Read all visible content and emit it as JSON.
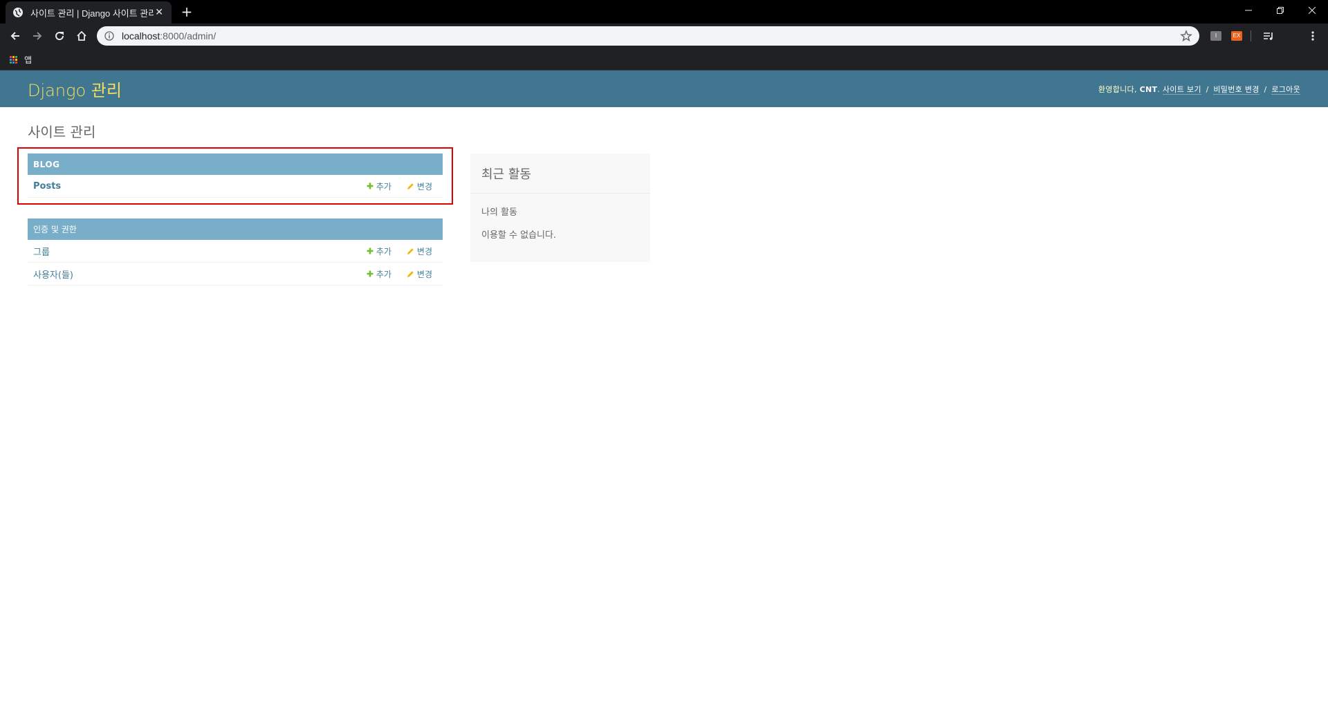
{
  "browser": {
    "tab_title": "사이트 관리 | Django 사이트 관리",
    "tab_close": "✕",
    "new_tab": "+",
    "url_host": "localhost",
    "url_rest": ":8000/admin/",
    "bookmarks": {
      "apps_label": "앱"
    },
    "extensions": {
      "ext1": "I",
      "ext2": "EX"
    }
  },
  "header": {
    "branding": "Django 관리",
    "welcome": "환영합니다,",
    "username": "CNT",
    "view_site": "사이트 보기",
    "change_password": "비밀번호 변경",
    "logout": "로그아웃",
    "separator": "/"
  },
  "content": {
    "title": "사이트 관리",
    "modules": [
      {
        "caption": "Blog",
        "rows": [
          {
            "name": "Posts",
            "add": "추가",
            "change": "변경"
          }
        ]
      },
      {
        "caption": "인증 및 권한",
        "rows": [
          {
            "name": "그룹",
            "add": "추가",
            "change": "변경"
          },
          {
            "name": "사용자(들)",
            "add": "추가",
            "change": "변경"
          }
        ]
      }
    ],
    "recent": {
      "title": "최근 활동",
      "subtitle": "나의 활동",
      "empty": "이용할 수 없습니다."
    }
  },
  "colors": {
    "header_bg": "#417690",
    "branding": "#f5dd5d",
    "module_caption_bg": "#79aec8",
    "link": "#447e9b",
    "add_icon": "#70bf2b",
    "change_icon": "#efb80b",
    "highlight_border": "#e00000"
  },
  "icons": [
    "globe-icon",
    "back-icon",
    "forward-icon",
    "reload-icon",
    "home-icon",
    "info-icon",
    "star-icon",
    "apps-icon",
    "plus-icon",
    "pencil-icon",
    "menu-icon"
  ]
}
